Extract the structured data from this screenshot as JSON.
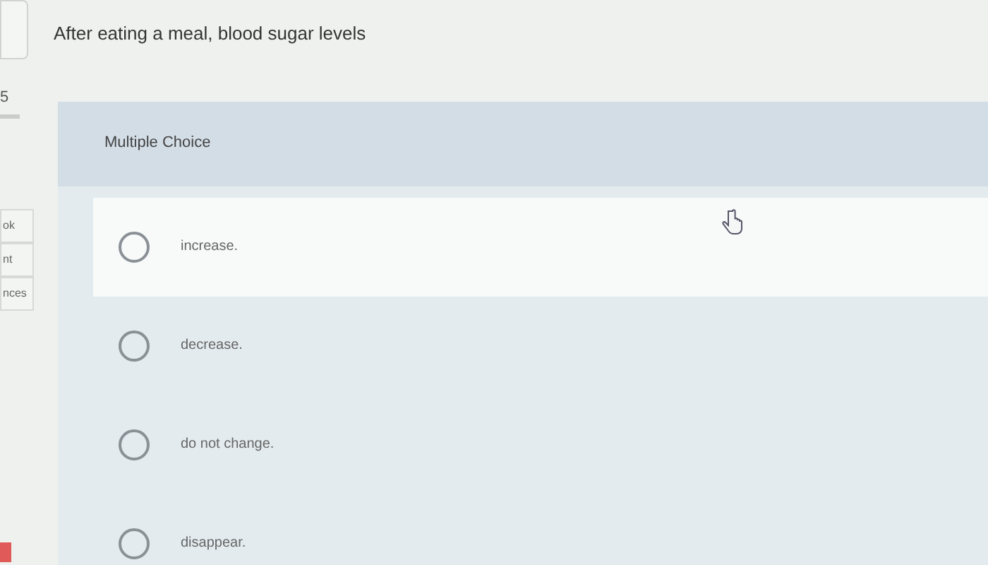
{
  "sidebar": {
    "number": "5",
    "items": [
      {
        "label": "ok"
      },
      {
        "label": "nt"
      },
      {
        "label": "nces"
      }
    ]
  },
  "question": "After eating a meal, blood sugar levels",
  "panel": {
    "title": "Multiple Choice",
    "options": [
      {
        "label": "increase.",
        "selected": false,
        "hovered": true
      },
      {
        "label": "decrease.",
        "selected": false,
        "hovered": false
      },
      {
        "label": "do not change.",
        "selected": false,
        "hovered": false
      },
      {
        "label": "disappear.",
        "selected": false,
        "hovered": false
      }
    ]
  }
}
